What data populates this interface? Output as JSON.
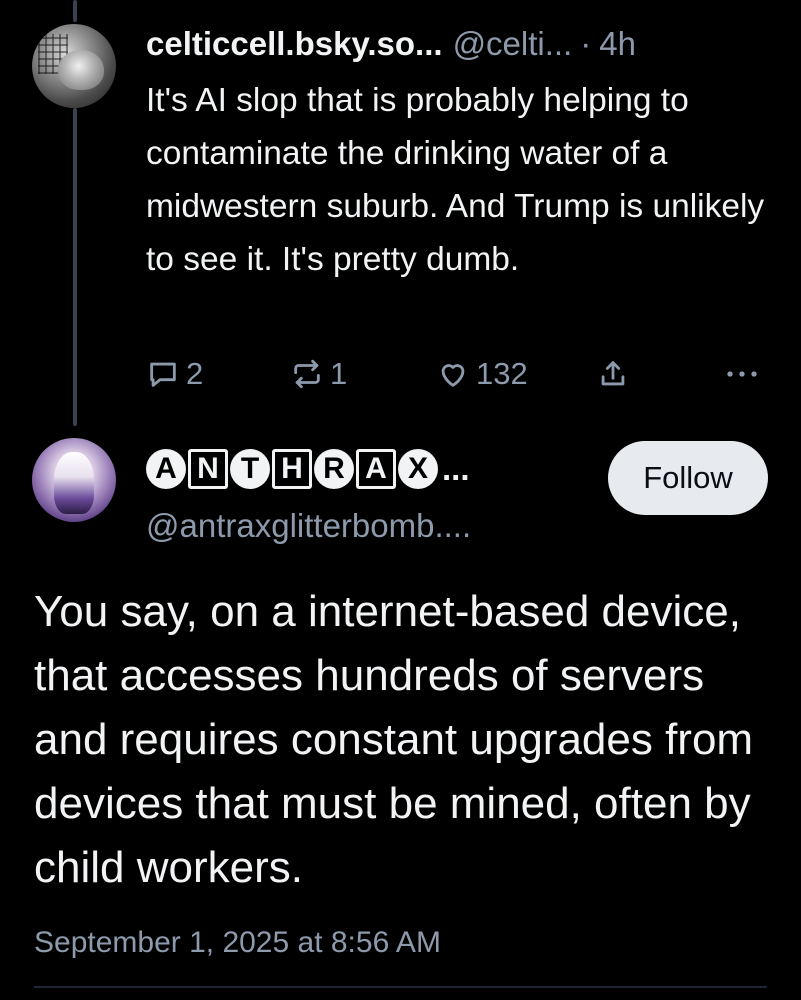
{
  "post1": {
    "author_name": "celticcell.bsky.so...",
    "handle": "@celti...",
    "separator": "·",
    "time": "4h",
    "text": "It's AI slop that is probably helping to contaminate the drinking water of a midwestern suburb. And Trump is unlikely to see it. It's pretty dumb.",
    "replies": "2",
    "reposts": "1",
    "likes": "132",
    "icons": {
      "reply": "speech-bubble-icon",
      "repost": "repost-arrows-icon",
      "like": "heart-icon",
      "share": "share-upload-icon",
      "more": "more-dots-icon"
    }
  },
  "post2": {
    "author_letters": [
      "A",
      "N",
      "T",
      "H",
      "R",
      "A",
      "X"
    ],
    "author_ellipsis": "...",
    "handle": "@antraxglitterbomb....",
    "follow_label": "Follow",
    "text": "You say, on a internet-based device, that accesses hundreds of servers and requires constant upgrades from devices that must be mined, often by child workers.",
    "date": "September 1, 2025 at 8:56 AM"
  },
  "colors": {
    "background": "#000000",
    "text": "#f2f3f5",
    "muted": "#8d9aac",
    "thread_line": "#3a4250",
    "follow_bg": "#e7ebf0"
  }
}
